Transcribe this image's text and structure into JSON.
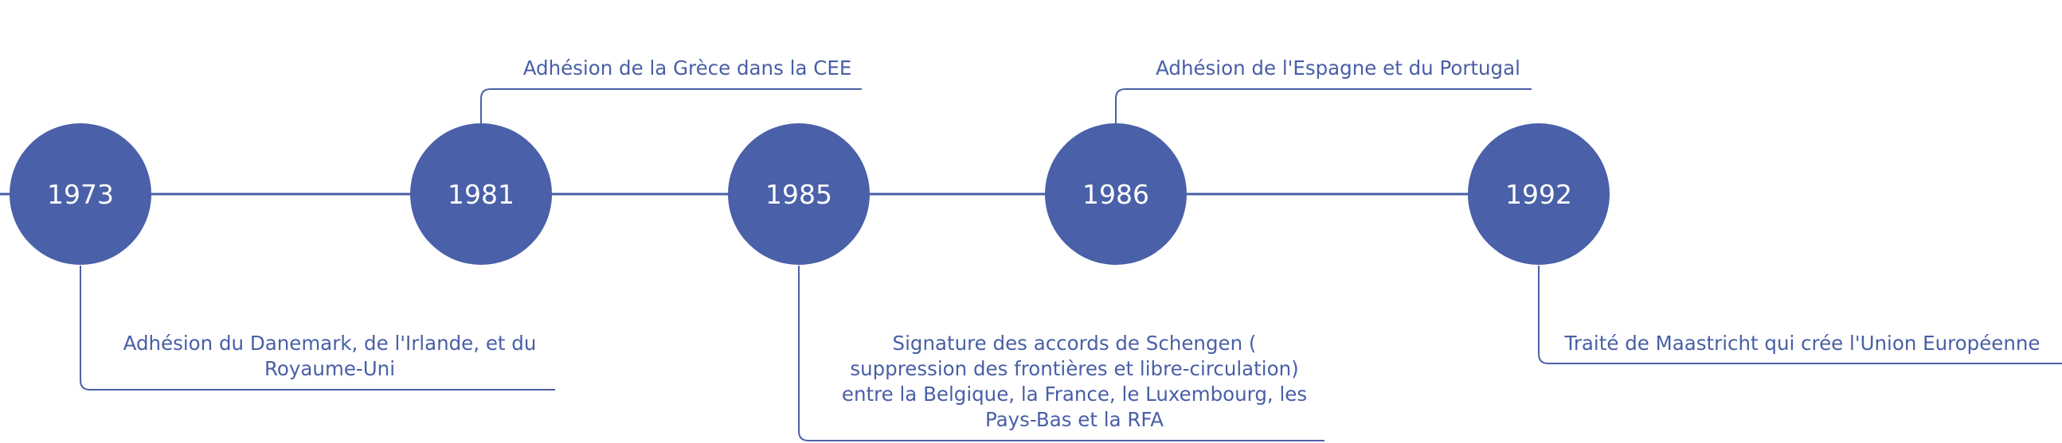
{
  "timeline": {
    "colors": {
      "accent": "#4a60a8",
      "line": "#4a60a8",
      "text": "#485fa6",
      "year_text": "#ffffff"
    },
    "events": [
      {
        "year": "1973",
        "lines": [
          "Adhésion du Danemark, de l'Irlande, et du",
          "Royaume-Uni"
        ]
      },
      {
        "year": "1981",
        "lines": [
          "Adhésion de la Grèce dans la CEE"
        ]
      },
      {
        "year": "1985",
        "lines": [
          "Signature des accords de Schengen (",
          "suppression des frontières et libre-circulation)",
          "entre la Belgique, la France, le Luxembourg, les",
          "Pays-Bas et la RFA"
        ]
      },
      {
        "year": "1986",
        "lines": [
          "Adhésion de l'Espagne et du Portugal"
        ]
      },
      {
        "year": "1992",
        "lines": [
          "Traité de Maastricht qui crée l'Union Européenne"
        ]
      }
    ]
  }
}
